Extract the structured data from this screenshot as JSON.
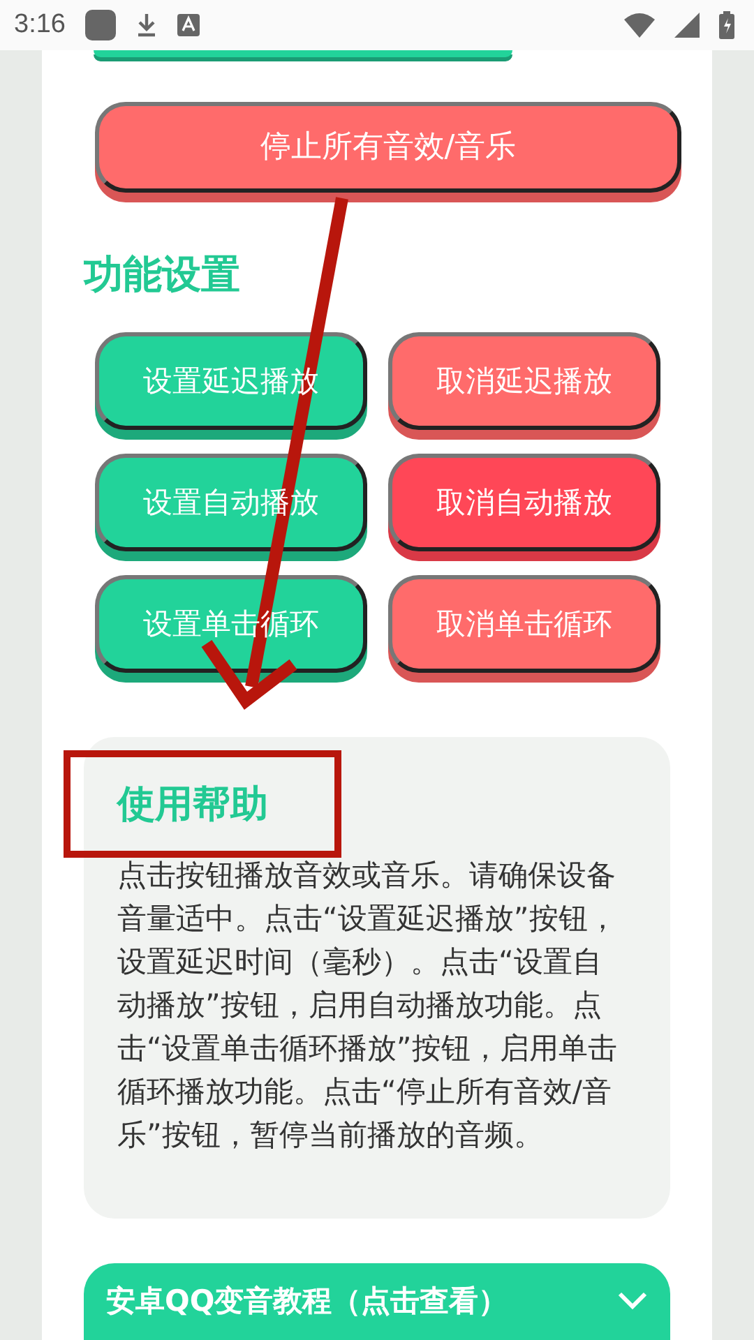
{
  "status_bar": {
    "time": "3:16"
  },
  "stop_button": {
    "label": "停止所有音效/音乐",
    "color": "#ff6b6b"
  },
  "settings": {
    "title": "功能设置",
    "buttons": [
      {
        "label": "设置延迟播放",
        "color": "#22d39a"
      },
      {
        "label": "取消延迟播放",
        "color": "#ff6b6b"
      },
      {
        "label": "设置自动播放",
        "color": "#22d39a"
      },
      {
        "label": "取消自动播放",
        "color": "#ff4757"
      },
      {
        "label": "设置单击循环",
        "color": "#22d39a"
      },
      {
        "label": "取消单击循环",
        "color": "#ff6b6b"
      }
    ]
  },
  "help": {
    "title": "使用帮助",
    "text": "点击按钮播放音效或音乐。请确保设备音量适中。点击“设置延迟播放”按钮，设置延迟时间（毫秒）。点击“设置自动播放”按钮，启用自动播放功能。点击“设置单击循环播放”按钮，启用单击循环播放功能。点击“停止所有音效/音乐”按钮，暂停当前播放的音频。"
  },
  "tutorial": {
    "label": "安卓QQ变音教程（点击查看）",
    "expanded": false
  }
}
